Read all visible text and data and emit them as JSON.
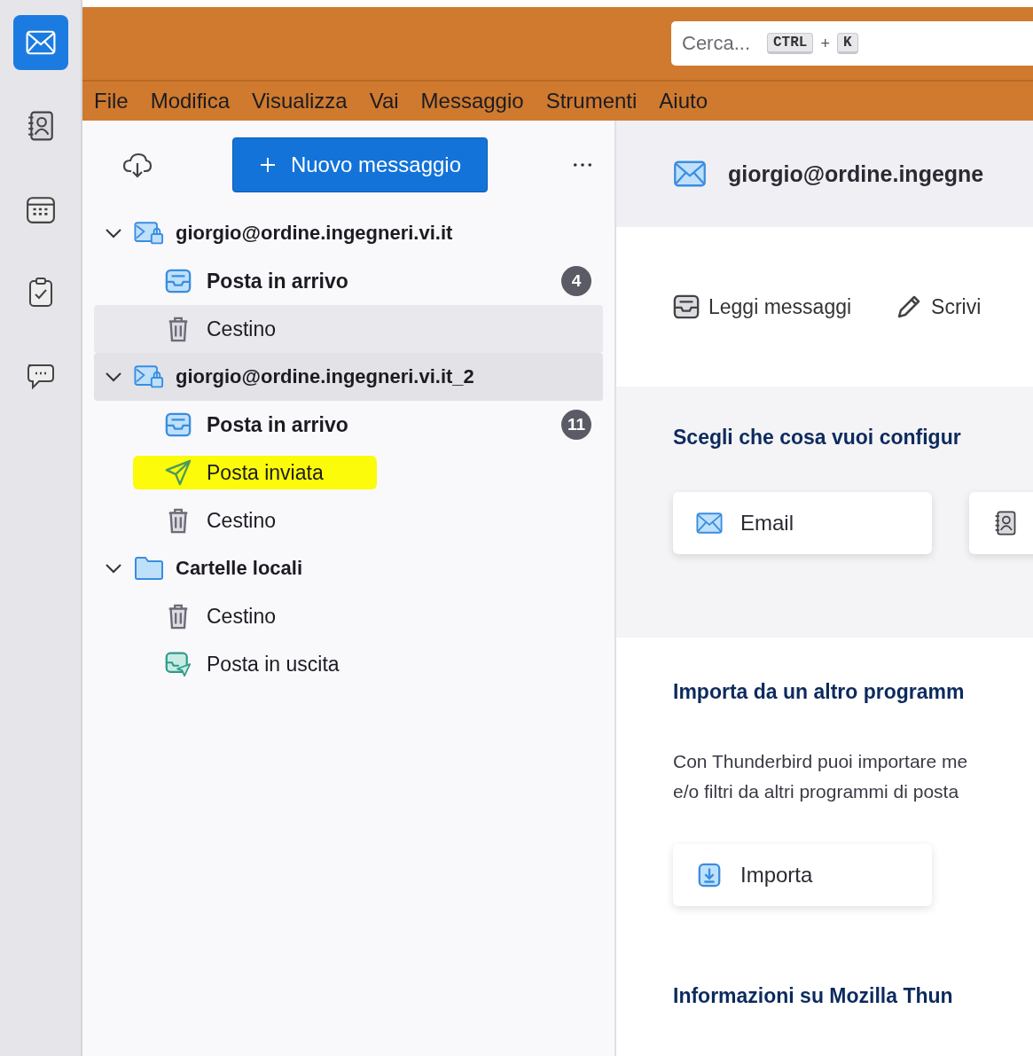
{
  "spaces": [
    {
      "kind": "mail",
      "selected": true
    },
    {
      "kind": "addressbook",
      "selected": false
    },
    {
      "kind": "calendar",
      "selected": false
    },
    {
      "kind": "tasks",
      "selected": false
    },
    {
      "kind": "chat",
      "selected": false
    }
  ],
  "search": {
    "placeholder": "Cerca...",
    "shortcut": [
      {
        "kind": "key",
        "text": "CTRL"
      },
      {
        "kind": "plus",
        "text": "+"
      },
      {
        "kind": "key",
        "text": "K"
      }
    ]
  },
  "menu": [
    "File",
    "Modifica",
    "Visualizza",
    "Vai",
    "Messaggio",
    "Strumenti",
    "Aiuto"
  ],
  "folder_pane": {
    "new_message": "Nuovo messaggio",
    "tree": [
      {
        "kind": "account",
        "label": "giorgio@ordine.ingegneri.vi.it",
        "expanded": true,
        "selected": false,
        "hovered": false,
        "children": [
          {
            "kind": "inbox",
            "label": "Posta in arrivo",
            "bold": true,
            "badge": "4",
            "selected": false,
            "hovered": false,
            "highlighted": false
          },
          {
            "kind": "trash",
            "label": "Cestino",
            "bold": false,
            "selected": false,
            "hovered": true,
            "highlighted": false
          }
        ]
      },
      {
        "kind": "account",
        "label": "giorgio@ordine.ingegneri.vi.it_2",
        "expanded": true,
        "selected": true,
        "hovered": false,
        "children": [
          {
            "kind": "inbox",
            "label": "Posta in arrivo",
            "bold": true,
            "badge": "11",
            "selected": false,
            "hovered": false,
            "highlighted": false
          },
          {
            "kind": "sent",
            "label": "Posta inviata",
            "bold": false,
            "selected": false,
            "hovered": false,
            "highlighted": true
          },
          {
            "kind": "trash",
            "label": "Cestino",
            "bold": false,
            "selected": false,
            "hovered": false,
            "highlighted": false
          }
        ]
      },
      {
        "kind": "local",
        "label": "Cartelle locali",
        "expanded": true,
        "selected": false,
        "hovered": false,
        "children": [
          {
            "kind": "trash",
            "label": "Cestino",
            "bold": false,
            "selected": false,
            "hovered": false,
            "highlighted": false
          },
          {
            "kind": "outbox",
            "label": "Posta in uscita",
            "bold": false,
            "selected": false,
            "hovered": false,
            "highlighted": false
          }
        ]
      }
    ]
  },
  "account_hub": {
    "title": "giorgio@ordine.ingegne",
    "actions": [
      {
        "kind": "read",
        "label": "Leggi messaggi"
      },
      {
        "kind": "write",
        "label": "Scrivi"
      }
    ],
    "setup_heading": "Scegli che cosa vuoi configur",
    "setup_cards": [
      {
        "kind": "email",
        "label": "Email"
      },
      {
        "kind": "addressbook"
      }
    ],
    "import_heading": "Importa da un altro programm",
    "import_text": [
      "Con Thunderbird puoi importare me",
      "e/o filtri da altri programmi di posta"
    ],
    "import_button": "Importa",
    "about_heading": "Informazioni su Mozilla Thun"
  }
}
